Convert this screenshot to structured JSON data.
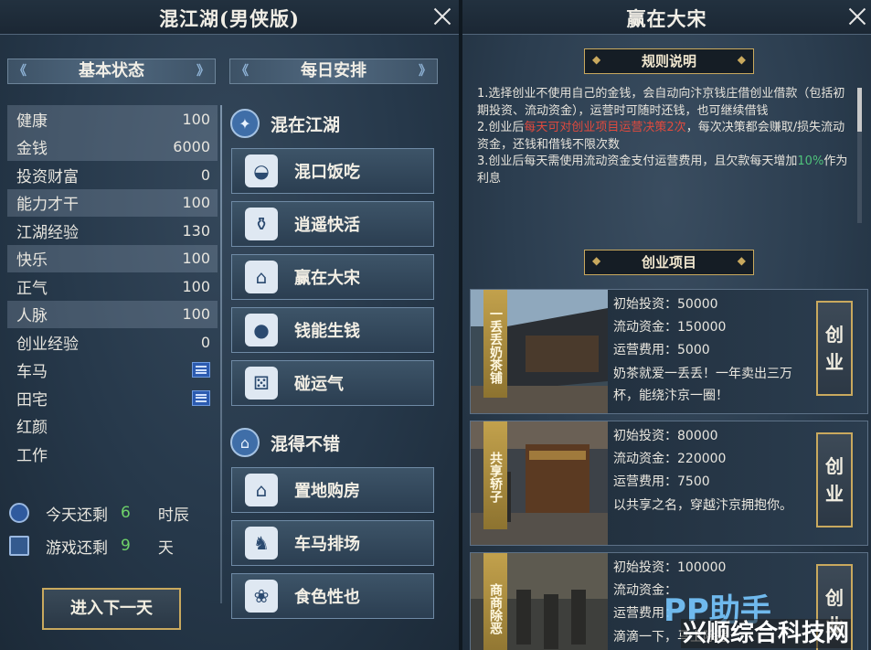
{
  "left_window": {
    "title": "混江湖(男侠版)",
    "basic_status": {
      "header": "基本状态"
    },
    "stats": [
      {
        "label": "健康",
        "value": "100",
        "highlight": true
      },
      {
        "label": "金钱",
        "value": "6000",
        "highlight": true
      },
      {
        "label": "投资财富",
        "value": "0",
        "highlight": false
      },
      {
        "label": "能力才干",
        "value": "100",
        "highlight": true
      },
      {
        "label": "江湖经验",
        "value": "130",
        "highlight": false
      },
      {
        "label": "快乐",
        "value": "100",
        "highlight": true
      },
      {
        "label": "正气",
        "value": "100",
        "highlight": false
      },
      {
        "label": "人脉",
        "value": "100",
        "highlight": true
      },
      {
        "label": "创业经验",
        "value": "0",
        "highlight": false
      },
      {
        "label": "车马",
        "value": "",
        "icon": "list-icon"
      },
      {
        "label": "田宅",
        "value": "",
        "icon": "list-icon"
      },
      {
        "label": "红颜",
        "value": ""
      },
      {
        "label": "工作",
        "value": ""
      }
    ],
    "time_left_today": {
      "label": "今天还剩",
      "value": "6",
      "unit": "时辰"
    },
    "game_left": {
      "label": "游戏还剩",
      "value": "9",
      "unit": "天"
    },
    "next_day_label": "进入下一天",
    "daily": {
      "header": "每日安排",
      "group1": {
        "title": "混在江湖",
        "icon": "flame-icon"
      },
      "group1_actions": [
        {
          "label": "混口饭吃",
          "icon": "rice-bowl-icon"
        },
        {
          "label": "逍遥快活",
          "icon": "wine-jar-icon"
        },
        {
          "label": "赢在大宋",
          "icon": "shop-icon"
        },
        {
          "label": "钱能生钱",
          "icon": "coins-icon"
        },
        {
          "label": "碰运气",
          "icon": "dice-icon"
        }
      ],
      "group2": {
        "title": "混得不错",
        "icon": "pavilion-icon"
      },
      "group2_actions": [
        {
          "label": "置地购房",
          "icon": "house-icon"
        },
        {
          "label": "车马排场",
          "icon": "horse-icon"
        },
        {
          "label": "食色性也",
          "icon": "flower-icon"
        }
      ]
    }
  },
  "right_window": {
    "title": "赢在大宋",
    "rules_header": "规则说明",
    "rules": {
      "r1": "1.选择创业不使用自己的金钱，会自动向汴京钱庄借创业借款（包括初期投资、流动资金），运营时可随时还钱，也可继续借钱",
      "r2_a": "2.创业后",
      "r2_red": "每天可对创业项目运营决策2次",
      "r2_b": "，每次决策都会赚取/损失流动资金，还钱和借钱不限次数",
      "r3_a": "3.创业后每天需使用流动资金支付运营费用，且欠款每天增加",
      "r3_green": "10%",
      "r3_b": "作为利息"
    },
    "projects_header": "创业项目",
    "labels": {
      "invest": "初始投资：",
      "flow": "流动资金：",
      "cost": "运营费用："
    },
    "button_label": "创业",
    "projects": [
      {
        "name": "一丢丢奶茶铺",
        "invest": "50000",
        "flow": "150000",
        "cost": "5000",
        "desc": "奶茶就爱一丢丢！一年卖出三万杯，能绕汴京一圈！"
      },
      {
        "name": "共享轿子",
        "invest": "80000",
        "flow": "220000",
        "cost": "7500",
        "desc": "以共享之名，穿越汴京拥抱你。"
      },
      {
        "name": "商商除恶",
        "invest": "100000",
        "flow": "",
        "cost": "",
        "desc": "滴滴一下，马上除恶"
      }
    ]
  },
  "watermark": {
    "line1": "PP助手",
    "line2": "兴顺综合科技网"
  },
  "colors": {
    "gold": "#c9a95e",
    "red_text": "#e04a3e",
    "green_text": "#4fc27b",
    "highlight_num": "#6fd26a"
  }
}
